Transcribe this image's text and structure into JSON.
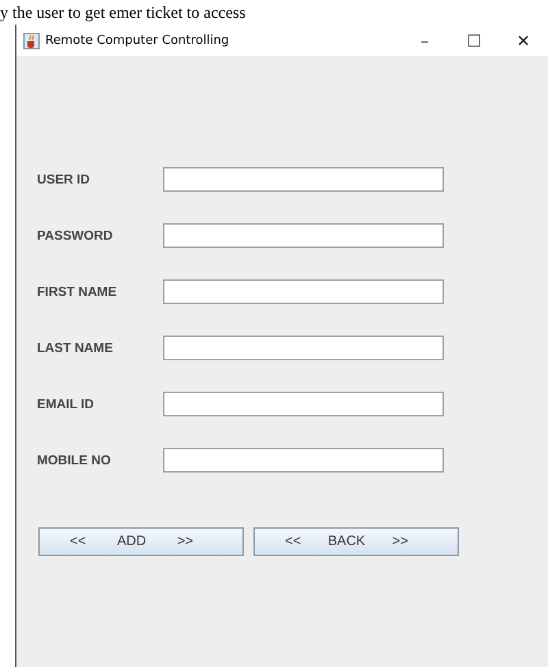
{
  "background_text": "y the user to get emer ticket to access",
  "window": {
    "title": "Remote Computer Controlling",
    "controls": [
      "–",
      "☐",
      "✕"
    ]
  },
  "fields": [
    {
      "label": "USER ID"
    },
    {
      "label": "PASSWORD"
    },
    {
      "label": "FIRST NAME"
    },
    {
      "label": "LAST NAME"
    },
    {
      "label": "EMAIL ID"
    },
    {
      "label": "MOBILE NO"
    }
  ],
  "buttons": [
    {
      "prefix": "<<",
      "label": "ADD",
      "suffix": ">>"
    },
    {
      "prefix": "<<",
      "label": "BACK",
      "suffix": ">>"
    }
  ]
}
